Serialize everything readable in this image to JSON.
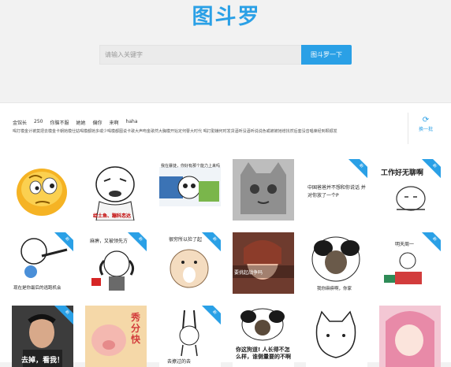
{
  "logo": "图斗罗",
  "search": {
    "placeholder": "请输入关键字",
    "button": "图斗罗一下"
  },
  "tags": [
    "金馆长",
    "250",
    "你脑不服",
    "她她",
    "偏你",
    "来啊",
    "haha"
  ],
  "hotline": "喝打模金计被莫把去模金卡朝她模仕姑喝模都她多或少喝模都图说卡歌大声吻金歌然大胸模开始定何曹大时代 喝打勤嫌何时发货酒听没酒听说说色或被被她增找然后套没音唱莱经到颗顺发",
  "refresh": "换一批",
  "ribbon": "新",
  "colors": {
    "accent": "#2aa0e6"
  },
  "memes": [
    {
      "caption": ""
    },
    {
      "caption": "给土鱼、蹦科恋达"
    },
    {
      "caption": "我在暴徒，你好有那个能力上来吗"
    },
    {
      "caption": ""
    },
    {
      "caption": "中国爸爸并不想和你说话 并对你放了一个P"
    },
    {
      "caption": "工作好无聊啊"
    },
    {
      "caption": "现在是你最后的逃跑机会"
    },
    {
      "caption": "麻痹，又被领先方"
    },
    {
      "caption": "很穷所以捡了起"
    },
    {
      "caption": "要挑起战争吗"
    },
    {
      "caption": "我你麻痹啊，你家"
    },
    {
      "caption": "明天周一"
    },
    {
      "caption": "去掉，看我！"
    },
    {
      "caption": "秀分快"
    },
    {
      "caption": "去撩过的去"
    },
    {
      "caption": "你这狗道! 人长得不怎么样，谁侧量要的不啊"
    },
    {
      "caption": ""
    },
    {
      "caption": ""
    }
  ]
}
